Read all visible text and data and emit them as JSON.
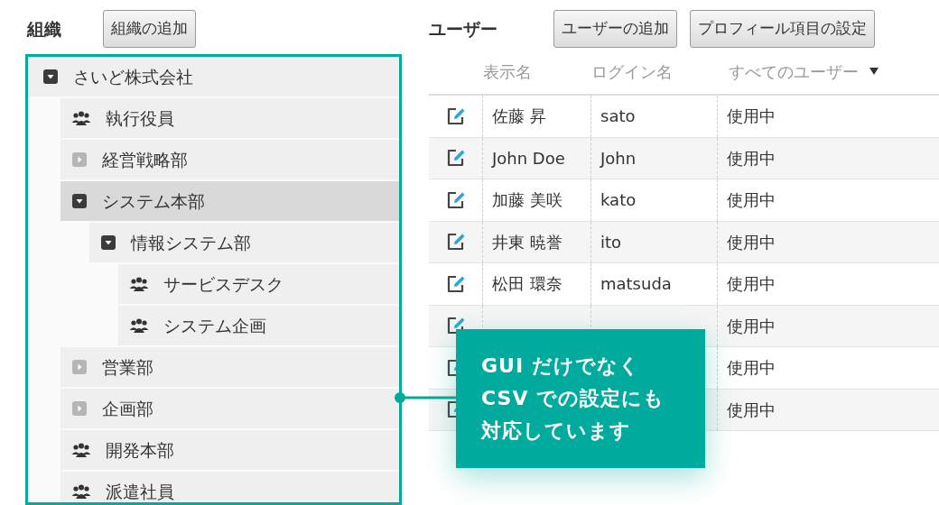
{
  "organization": {
    "title": "組織",
    "add_button": "組織の追加",
    "tree": [
      {
        "label": "さいど株式会社",
        "kind": "folder",
        "expanded": true,
        "selected": false,
        "children": [
          {
            "label": "執行役員",
            "kind": "group",
            "selected": false
          },
          {
            "label": "経営戦略部",
            "kind": "folder",
            "expanded": false,
            "selected": false
          },
          {
            "label": "システム本部",
            "kind": "folder",
            "expanded": true,
            "selected": true,
            "children": [
              {
                "label": "情報システム部",
                "kind": "folder",
                "expanded": true,
                "selected": false,
                "children": [
                  {
                    "label": "サービスデスク",
                    "kind": "group",
                    "selected": false
                  },
                  {
                    "label": "システム企画",
                    "kind": "group",
                    "selected": false
                  }
                ]
              }
            ]
          },
          {
            "label": "営業部",
            "kind": "folder",
            "expanded": false,
            "selected": false
          },
          {
            "label": "企画部",
            "kind": "folder",
            "expanded": false,
            "selected": false
          },
          {
            "label": "開発本部",
            "kind": "group",
            "selected": false
          },
          {
            "label": "派遣社員",
            "kind": "group",
            "selected": false
          }
        ]
      }
    ]
  },
  "users": {
    "title": "ユーザー",
    "buttons": [
      "ユーザーの追加",
      "プロフィール項目の設定"
    ],
    "columns": [
      "表示名",
      "ログイン名",
      "すべてのユーザー"
    ],
    "rows": [
      {
        "name": "佐藤 昇",
        "login": "sato",
        "status": "使用中"
      },
      {
        "name": "John Doe",
        "login": "John",
        "status": "使用中"
      },
      {
        "name": "加藤 美咲",
        "login": "kato",
        "status": "使用中"
      },
      {
        "name": "井東 暁誉",
        "login": "ito",
        "status": "使用中"
      },
      {
        "name": "松田 環奈",
        "login": "matsuda",
        "status": "使用中"
      },
      {
        "status": "使用中"
      },
      {
        "status": "使用中"
      },
      {
        "status": "使用中"
      }
    ]
  },
  "callout": {
    "lines": [
      "GUI だけでなく",
      "CSV での設定にも",
      "対応しています"
    ]
  }
}
